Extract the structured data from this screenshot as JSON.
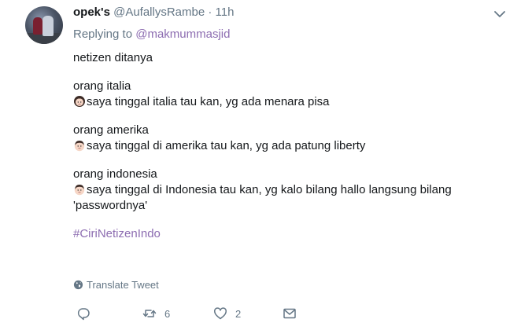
{
  "tweet": {
    "display_name": "opek's",
    "handle": "@AufallysRambe",
    "separator": "·",
    "time": "11h",
    "replying_prefix": "Replying to",
    "replying_to": "@makmummasjid",
    "lines": [
      "netizen ditanya",
      "orang italia",
      "saya tinggal italia tau kan, yg ada menara pisa",
      "orang amerika",
      "saya tinggal di amerika tau kan, yg ada patung liberty",
      "orang indonesia",
      "saya tinggal di Indonesia tau kan, yg kalo bilang hallo langsung bilang",
      "'passwordnya'"
    ],
    "hashtag": "#CiriNetizenIndo",
    "translate_label": "Translate Tweet",
    "retweet_count": "6",
    "like_count": "2"
  },
  "icons": {
    "caret": "chevron-down-icon",
    "globe": "globe-icon",
    "reply": "reply-icon",
    "retweet": "retweet-icon",
    "like": "heart-icon",
    "dm": "envelope-icon",
    "emoji_girl": "girl-face-emoji",
    "emoji_man": "man-face-emoji"
  },
  "colors": {
    "link": "#8d6db1",
    "muted": "#657786",
    "text": "#14171a"
  }
}
